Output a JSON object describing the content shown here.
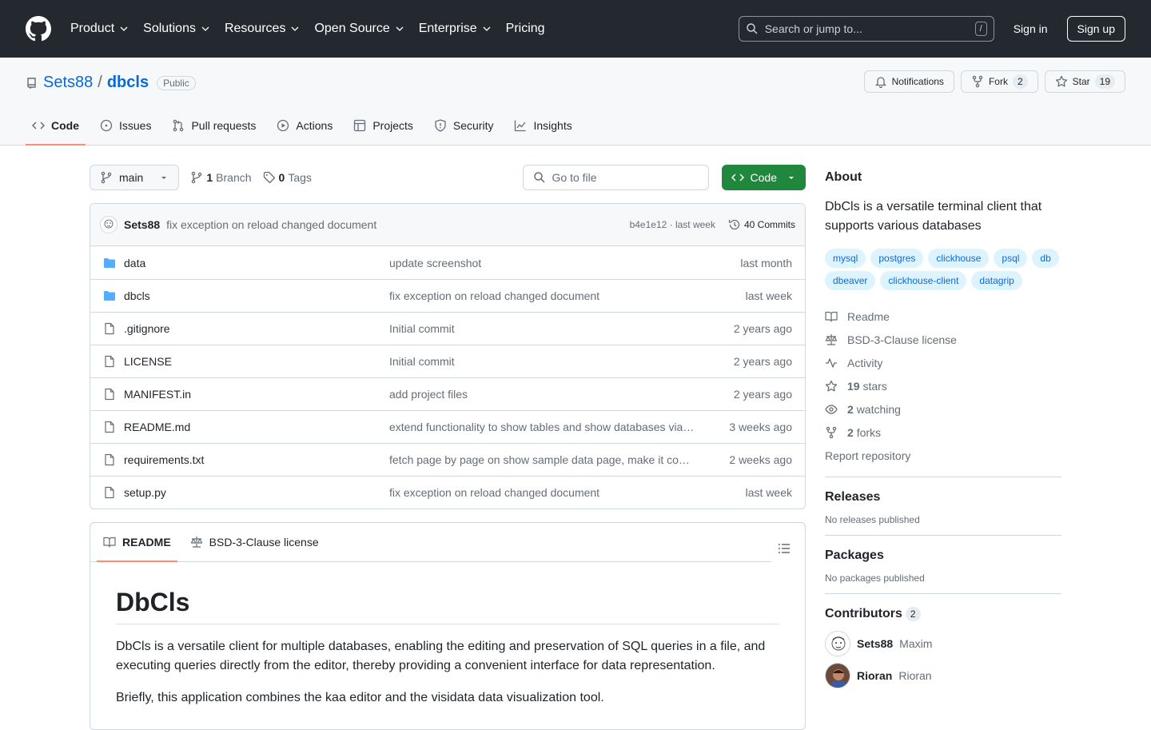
{
  "header": {
    "nav": [
      "Product",
      "Solutions",
      "Resources",
      "Open Source",
      "Enterprise",
      "Pricing"
    ],
    "search_placeholder": "Search or jump to...",
    "search_shortcut": "/",
    "signin": "Sign in",
    "signup": "Sign up"
  },
  "repo": {
    "owner": "Sets88",
    "separator": "/",
    "name": "dbcls",
    "visibility": "Public",
    "notifications": "Notifications",
    "fork_label": "Fork",
    "fork_count": "2",
    "star_label": "Star",
    "star_count": "19",
    "tabs": [
      "Code",
      "Issues",
      "Pull requests",
      "Actions",
      "Projects",
      "Security",
      "Insights"
    ]
  },
  "toolbar": {
    "branch": "main",
    "branch_count": "1",
    "branch_label": "Branch",
    "tag_count": "0",
    "tag_label": "Tags",
    "goto_placeholder": "Go to file",
    "code_button": "Code"
  },
  "commit": {
    "author": "Sets88",
    "message": "fix exception on reload changed document",
    "sha_time": "b4e1e12 · last week",
    "commits": "40 Commits"
  },
  "files": [
    {
      "name": "data",
      "type": "dir",
      "message": "update screenshot",
      "date": "last month"
    },
    {
      "name": "dbcls",
      "type": "dir",
      "message": "fix exception on reload changed document",
      "date": "last week"
    },
    {
      "name": ".gitignore",
      "type": "file",
      "message": "Initial commit",
      "date": "2 years ago"
    },
    {
      "name": "LICENSE",
      "type": "file",
      "message": "Initial commit",
      "date": "2 years ago"
    },
    {
      "name": "MANIFEST.in",
      "type": "file",
      "message": "add project files",
      "date": "2 years ago"
    },
    {
      "name": "README.md",
      "type": "file",
      "message": "extend functionality to show tables and show databases via…",
      "date": "3 weeks ago"
    },
    {
      "name": "requirements.txt",
      "type": "file",
      "message": "fetch page by page on show sample data page, make it co…",
      "date": "2 weeks ago"
    },
    {
      "name": "setup.py",
      "type": "file",
      "message": "fix exception on reload changed document",
      "date": "last week"
    }
  ],
  "readme": {
    "tab_readme": "README",
    "tab_license": "BSD-3-Clause license",
    "title": "DbCls",
    "p1": "DbCls is a versatile client for multiple databases, enabling the editing and preservation of SQL queries in a file, and executing queries directly from the editor, thereby providing a convenient interface for data representation.",
    "p2": "Briefly, this application combines the kaa editor and the visidata data visualization tool."
  },
  "about": {
    "heading": "About",
    "description": "DbCls is a versatile terminal client that supports various databases",
    "topics": [
      "mysql",
      "postgres",
      "clickhouse",
      "psql",
      "db",
      "dbeaver",
      "clickhouse-client",
      "datagrip"
    ],
    "readme": "Readme",
    "license": "BSD-3-Clause license",
    "activity": "Activity",
    "stars_count": "19",
    "stars_label": "stars",
    "watching_count": "2",
    "watching_label": "watching",
    "forks_count": "2",
    "forks_label": "forks",
    "report": "Report repository"
  },
  "releases": {
    "heading": "Releases",
    "text": "No releases published"
  },
  "packages": {
    "heading": "Packages",
    "text": "No packages published"
  },
  "contributors": {
    "heading": "Contributors",
    "count": "2",
    "list": [
      {
        "login": "Sets88",
        "name": "Maxim"
      },
      {
        "login": "Rioran",
        "name": "Rioran"
      }
    ]
  },
  "colors": {
    "accent": "#0969da",
    "green": "#1f883d",
    "header_bg": "#24292f",
    "tab_underline": "#fd8c73"
  }
}
